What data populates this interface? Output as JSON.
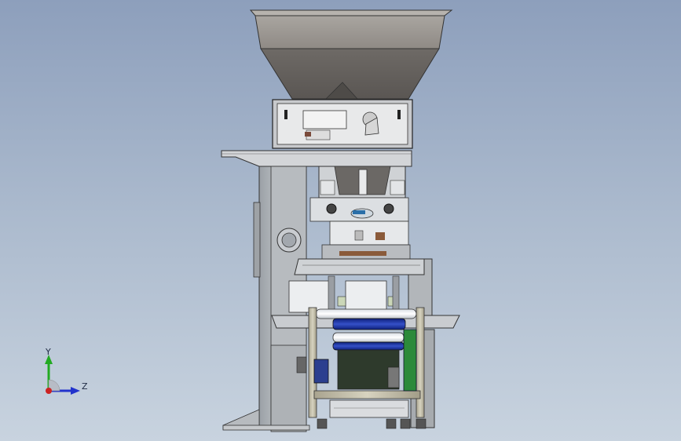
{
  "viewport": {
    "background_top": "#8d9fbc",
    "background_bottom": "#c8d3df"
  },
  "model": {
    "description_icon": "packaging-machine-model"
  },
  "triad": {
    "x_axis_color": "#cc2222",
    "y_axis_color": "#22aa22",
    "z_axis_color": "#2233cc",
    "y_label": "Y",
    "z_label": "Z"
  }
}
